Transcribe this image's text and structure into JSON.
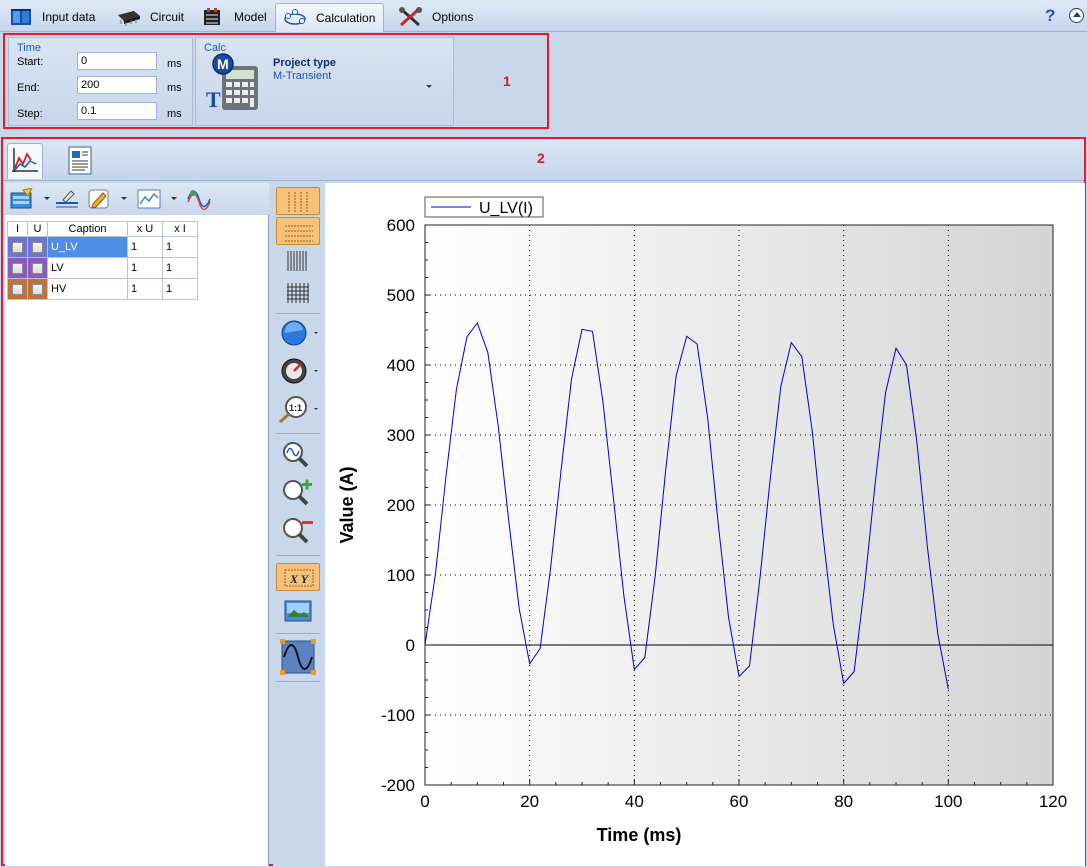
{
  "menubar": {
    "tabs": [
      {
        "label": "Input data",
        "icon": "database-icon"
      },
      {
        "label": "Circuit",
        "icon": "chip-icon"
      },
      {
        "label": "Model",
        "icon": "transformer-icon"
      },
      {
        "label": "Calculation",
        "icon": "calculation-icon",
        "active": true
      },
      {
        "label": "Options",
        "icon": "tools-icon"
      }
    ],
    "help": "?"
  },
  "ribbon": {
    "marker": "1",
    "time_group": {
      "title": "Time",
      "start_label": "Start:",
      "start_value": "0",
      "start_unit": "ms",
      "end_label": "End:",
      "end_value": "200",
      "end_unit": "ms",
      "step_label": "Step:",
      "step_value": "0.1",
      "step_unit": "ms"
    },
    "calc_group": {
      "title": "Calc",
      "project_type_label": "Project type",
      "project_type_value": "M-Transient"
    }
  },
  "main": {
    "marker": "2",
    "table": {
      "headers": [
        "I",
        "U",
        "Caption",
        "x U",
        "x I"
      ],
      "rows": [
        {
          "caption": "U_LV",
          "xu": "1",
          "xi": "1",
          "color": "#6b73d6",
          "selected": true
        },
        {
          "caption": "LV",
          "xu": "1",
          "xi": "1",
          "color": "#8a5bbf",
          "selected": false
        },
        {
          "caption": "HV",
          "xu": "1",
          "xi": "1",
          "color": "#c0703a",
          "selected": false
        }
      ]
    }
  },
  "chart_data": {
    "type": "line",
    "xlabel": "Time (ms)",
    "ylabel": "Value (A)",
    "xlim": [
      0,
      120
    ],
    "ylim": [
      -200,
      600
    ],
    "xticks": [
      0,
      20,
      40,
      60,
      80,
      100,
      120
    ],
    "yticks": [
      -200,
      -100,
      0,
      100,
      200,
      300,
      400,
      500,
      600
    ],
    "grid": true,
    "legend": "top-left",
    "series": [
      {
        "name": "U_LV(I)",
        "color": "#0000cc",
        "x": [
          0,
          2,
          4,
          6,
          8,
          10,
          12,
          14,
          16,
          18,
          20,
          22,
          24,
          26,
          28,
          30,
          32,
          34,
          36,
          38,
          40,
          42,
          44,
          46,
          48,
          50,
          52,
          54,
          56,
          58,
          60,
          62,
          64,
          66,
          68,
          70,
          72,
          74,
          76,
          78,
          80,
          82,
          84,
          86,
          88,
          90,
          92,
          94,
          96,
          98,
          100
        ],
        "y": [
          0,
          102,
          240,
          365,
          440,
          460,
          418,
          312,
          178,
          52,
          -27,
          -5,
          110,
          250,
          380,
          451,
          448,
          348,
          210,
          70,
          -35,
          -18,
          100,
          250,
          385,
          441,
          430,
          325,
          175,
          40,
          -45,
          -30,
          95,
          240,
          370,
          432,
          412,
          305,
          160,
          30,
          -55,
          -38,
          85,
          230,
          360,
          424,
          400,
          290,
          140,
          15,
          -63
        ]
      }
    ]
  }
}
